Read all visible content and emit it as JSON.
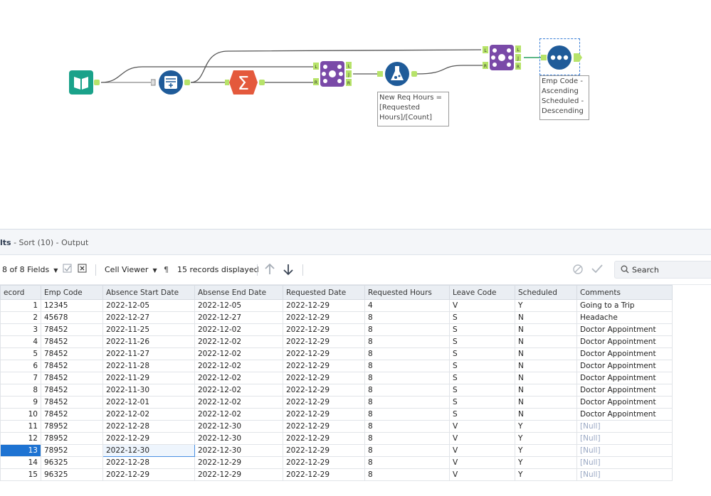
{
  "canvas": {
    "formula_annotation": [
      "New Req Hours =",
      "[Requested",
      "Hours]/[Count]"
    ],
    "sort_annotation": [
      "Emp Code -",
      "Ascending",
      "Scheduled -",
      "Descending"
    ],
    "anchor_labels": {
      "left": "L",
      "join": "J",
      "right": "R"
    }
  },
  "results": {
    "title_prefix": "lts",
    "title_rest": " - Sort (10) - Output",
    "toolbar": {
      "fields": "8 of 8 Fields",
      "cell_viewer": "Cell Viewer",
      "records_displayed": "15 records displayed",
      "search_placeholder": "Search"
    },
    "columns": [
      "ecord",
      "Emp Code",
      "Absence Start Date",
      "Absense End Date",
      "Requested Date",
      "Requested Hours",
      "Leave Code",
      "Scheduled",
      "Comments"
    ],
    "rows": [
      [
        "1",
        "12345",
        "2022-12-05",
        "2022-12-05",
        "2022-12-29",
        "4",
        "V",
        "Y",
        "Going to a Trip"
      ],
      [
        "2",
        "45678",
        "2022-12-27",
        "2022-12-27",
        "2022-12-29",
        "8",
        "S",
        "N",
        "Headache"
      ],
      [
        "3",
        "78452",
        "2022-11-25",
        "2022-12-02",
        "2022-12-29",
        "8",
        "S",
        "N",
        "Doctor Appointment"
      ],
      [
        "4",
        "78452",
        "2022-11-26",
        "2022-12-02",
        "2022-12-29",
        "8",
        "S",
        "N",
        "Doctor Appointment"
      ],
      [
        "5",
        "78452",
        "2022-11-27",
        "2022-12-02",
        "2022-12-29",
        "8",
        "S",
        "N",
        "Doctor Appointment"
      ],
      [
        "6",
        "78452",
        "2022-11-28",
        "2022-12-02",
        "2022-12-29",
        "8",
        "S",
        "N",
        "Doctor Appointment"
      ],
      [
        "7",
        "78452",
        "2022-11-29",
        "2022-12-02",
        "2022-12-29",
        "8",
        "S",
        "N",
        "Doctor Appointment"
      ],
      [
        "8",
        "78452",
        "2022-11-30",
        "2022-12-02",
        "2022-12-29",
        "8",
        "S",
        "N",
        "Doctor Appointment"
      ],
      [
        "9",
        "78452",
        "2022-12-01",
        "2022-12-02",
        "2022-12-29",
        "8",
        "S",
        "N",
        "Doctor Appointment"
      ],
      [
        "10",
        "78452",
        "2022-12-02",
        "2022-12-02",
        "2022-12-29",
        "8",
        "S",
        "N",
        "Doctor Appointment"
      ],
      [
        "11",
        "78952",
        "2022-12-28",
        "2022-12-30",
        "2022-12-29",
        "8",
        "V",
        "Y",
        "[Null]"
      ],
      [
        "12",
        "78952",
        "2022-12-29",
        "2022-12-30",
        "2022-12-29",
        "8",
        "V",
        "Y",
        "[Null]"
      ],
      [
        "13",
        "78952",
        "2022-12-30",
        "2022-12-30",
        "2022-12-29",
        "8",
        "V",
        "Y",
        "[Null]"
      ],
      [
        "14",
        "96325",
        "2022-12-28",
        "2022-12-29",
        "2022-12-29",
        "8",
        "V",
        "Y",
        "[Null]"
      ],
      [
        "15",
        "96325",
        "2022-12-29",
        "2022-12-29",
        "2022-12-29",
        "8",
        "V",
        "Y",
        "[Null]"
      ]
    ],
    "selected_row": 13,
    "colors": {
      "accent": "#1e73d2",
      "null_text": "#9aa8c4"
    }
  }
}
